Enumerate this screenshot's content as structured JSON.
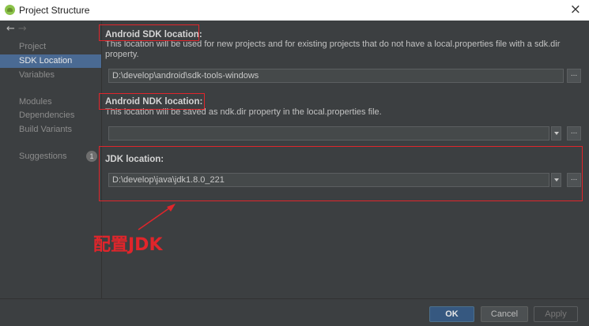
{
  "window": {
    "title": "Project Structure",
    "close_icon": "close-icon"
  },
  "sidebar": {
    "nav_back": "←",
    "nav_forward": "→",
    "items": [
      {
        "label": "Project"
      },
      {
        "label": "SDK Location"
      },
      {
        "label": "Variables"
      },
      {
        "label": "Modules"
      },
      {
        "label": "Dependencies"
      },
      {
        "label": "Build Variants"
      },
      {
        "label": "Suggestions",
        "badge": "1"
      }
    ]
  },
  "sdk": {
    "title": "Android SDK location:",
    "description": "This location will be used for new projects and for existing projects that do not have a local.properties file with a sdk.dir property.",
    "value": "D:\\develop\\android\\sdk-tools-windows",
    "browse": "..."
  },
  "ndk": {
    "title": "Android NDK location:",
    "description": "This location will be saved as ndk.dir property in the local.properties file.",
    "value": "",
    "browse": "..."
  },
  "jdk": {
    "title": "JDK location:",
    "value": "D:\\develop\\java\\jdk1.8.0_221",
    "browse": "..."
  },
  "annotation": {
    "text": "配置JDK",
    "color": "#e0252b"
  },
  "footer": {
    "ok": "OK",
    "cancel": "Cancel",
    "apply": "Apply"
  },
  "colors": {
    "background": "#3c3f41",
    "selected": "#4a6a93",
    "primary_button": "#365880",
    "highlight": "#e0252b"
  }
}
